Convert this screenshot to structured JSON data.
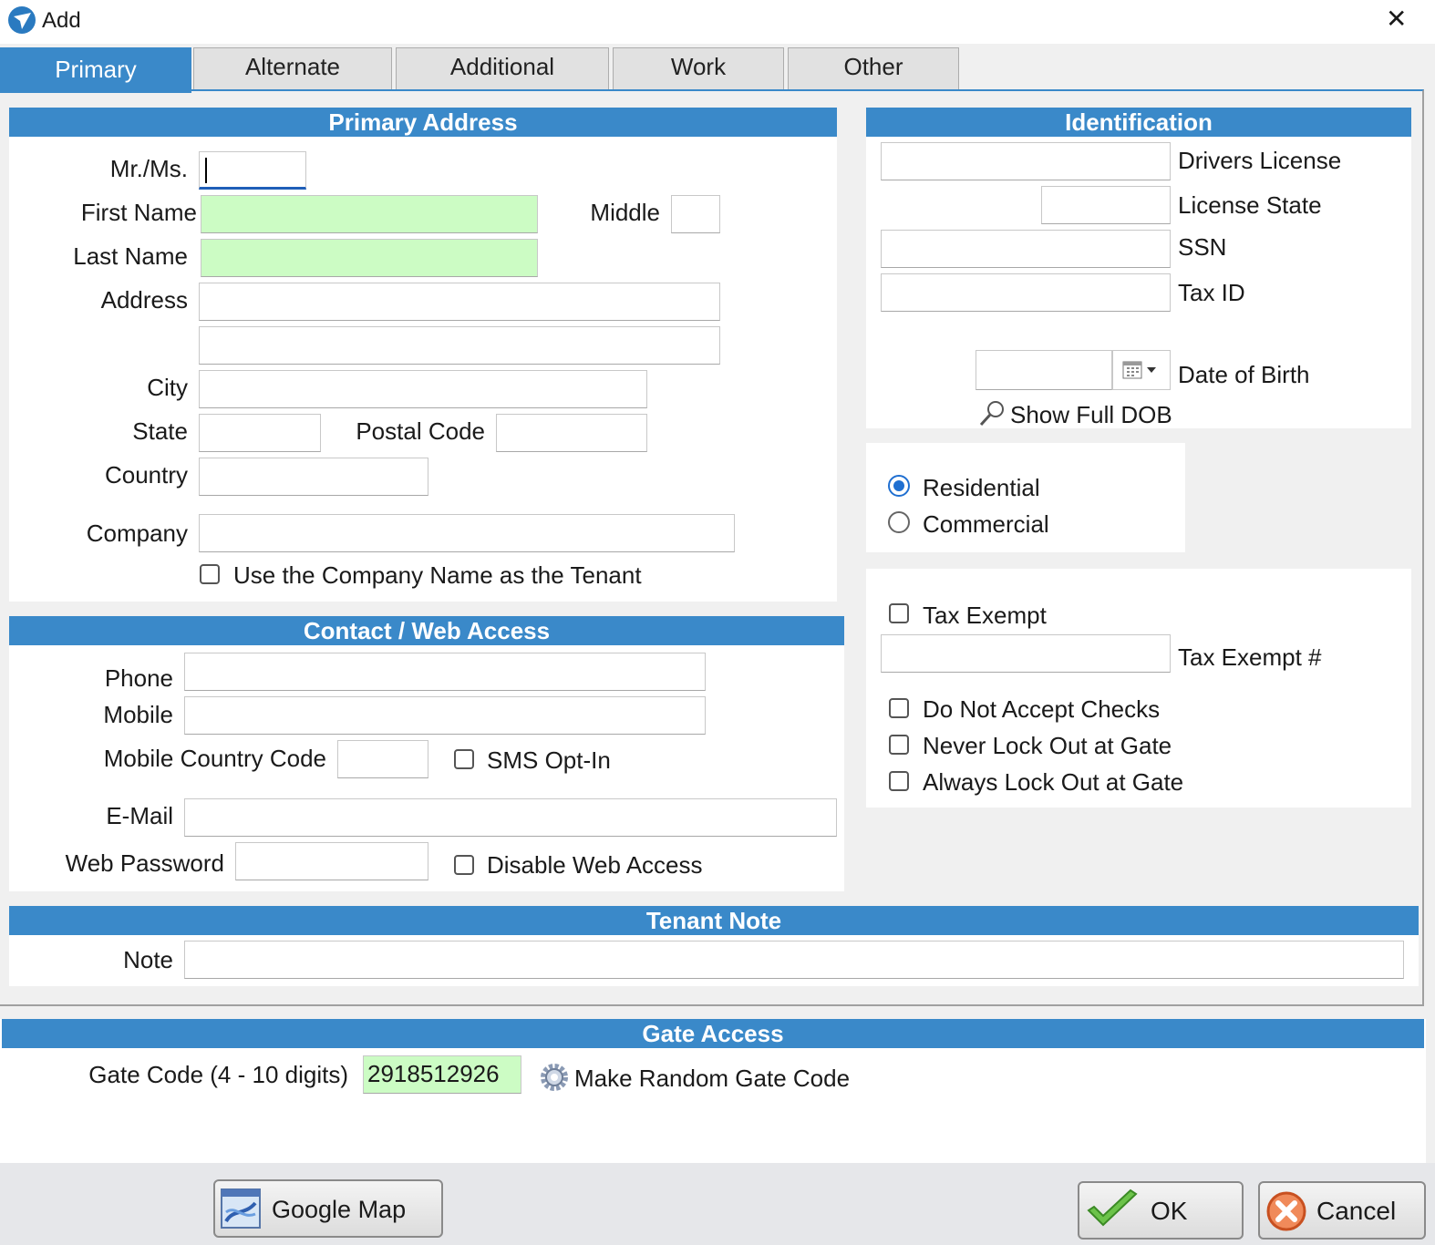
{
  "window": {
    "title": "Add",
    "close_glyph": "✕"
  },
  "tabs": [
    {
      "label": "Primary"
    },
    {
      "label": "Alternate"
    },
    {
      "label": "Additional"
    },
    {
      "label": "Work"
    },
    {
      "label": "Other"
    }
  ],
  "primary_address": {
    "header": "Primary Address",
    "mr_ms_label": "Mr./Ms.",
    "first_name_label": "First Name",
    "middle_label": "Middle",
    "last_name_label": "Last Name",
    "address_label": "Address",
    "city_label": "City",
    "state_label": "State",
    "postal_code_label": "Postal Code",
    "country_label": "Country",
    "company_label": "Company",
    "use_company_label": "Use the Company Name as the Tenant"
  },
  "identification": {
    "header": "Identification",
    "drivers_license_label": "Drivers License",
    "license_state_label": "License State",
    "ssn_label": "SSN",
    "tax_id_label": "Tax ID",
    "dob_label": "Date of Birth",
    "show_full_dob_label": "Show Full DOB"
  },
  "type": {
    "residential_label": "Residential",
    "commercial_label": "Commercial",
    "selected": "Residential"
  },
  "flags": {
    "tax_exempt_label": "Tax Exempt",
    "tax_exempt_num_label": "Tax Exempt #",
    "no_checks_label": "Do Not Accept Checks",
    "never_lock_label": "Never Lock Out at Gate",
    "always_lock_label": "Always Lock Out at Gate"
  },
  "contact": {
    "header": "Contact / Web Access",
    "phone_label": "Phone",
    "mobile_label": "Mobile",
    "mobile_cc_label": "Mobile Country Code",
    "sms_label": "SMS Opt-In",
    "email_label": "E-Mail",
    "web_password_label": "Web Password",
    "disable_web_label": "Disable Web Access"
  },
  "note": {
    "header": "Tenant Note",
    "note_label": "Note"
  },
  "gate": {
    "header": "Gate Access",
    "gate_code_label": "Gate Code (4 - 10 digits)",
    "gate_code_value": "2918512926",
    "random_label": "Make Random Gate Code"
  },
  "footer": {
    "google_map_label": "Google Map",
    "ok_label": "OK",
    "cancel_label": "Cancel"
  },
  "colors": {
    "accent": "#3a89c9",
    "required_field": "#ccfcc4"
  }
}
